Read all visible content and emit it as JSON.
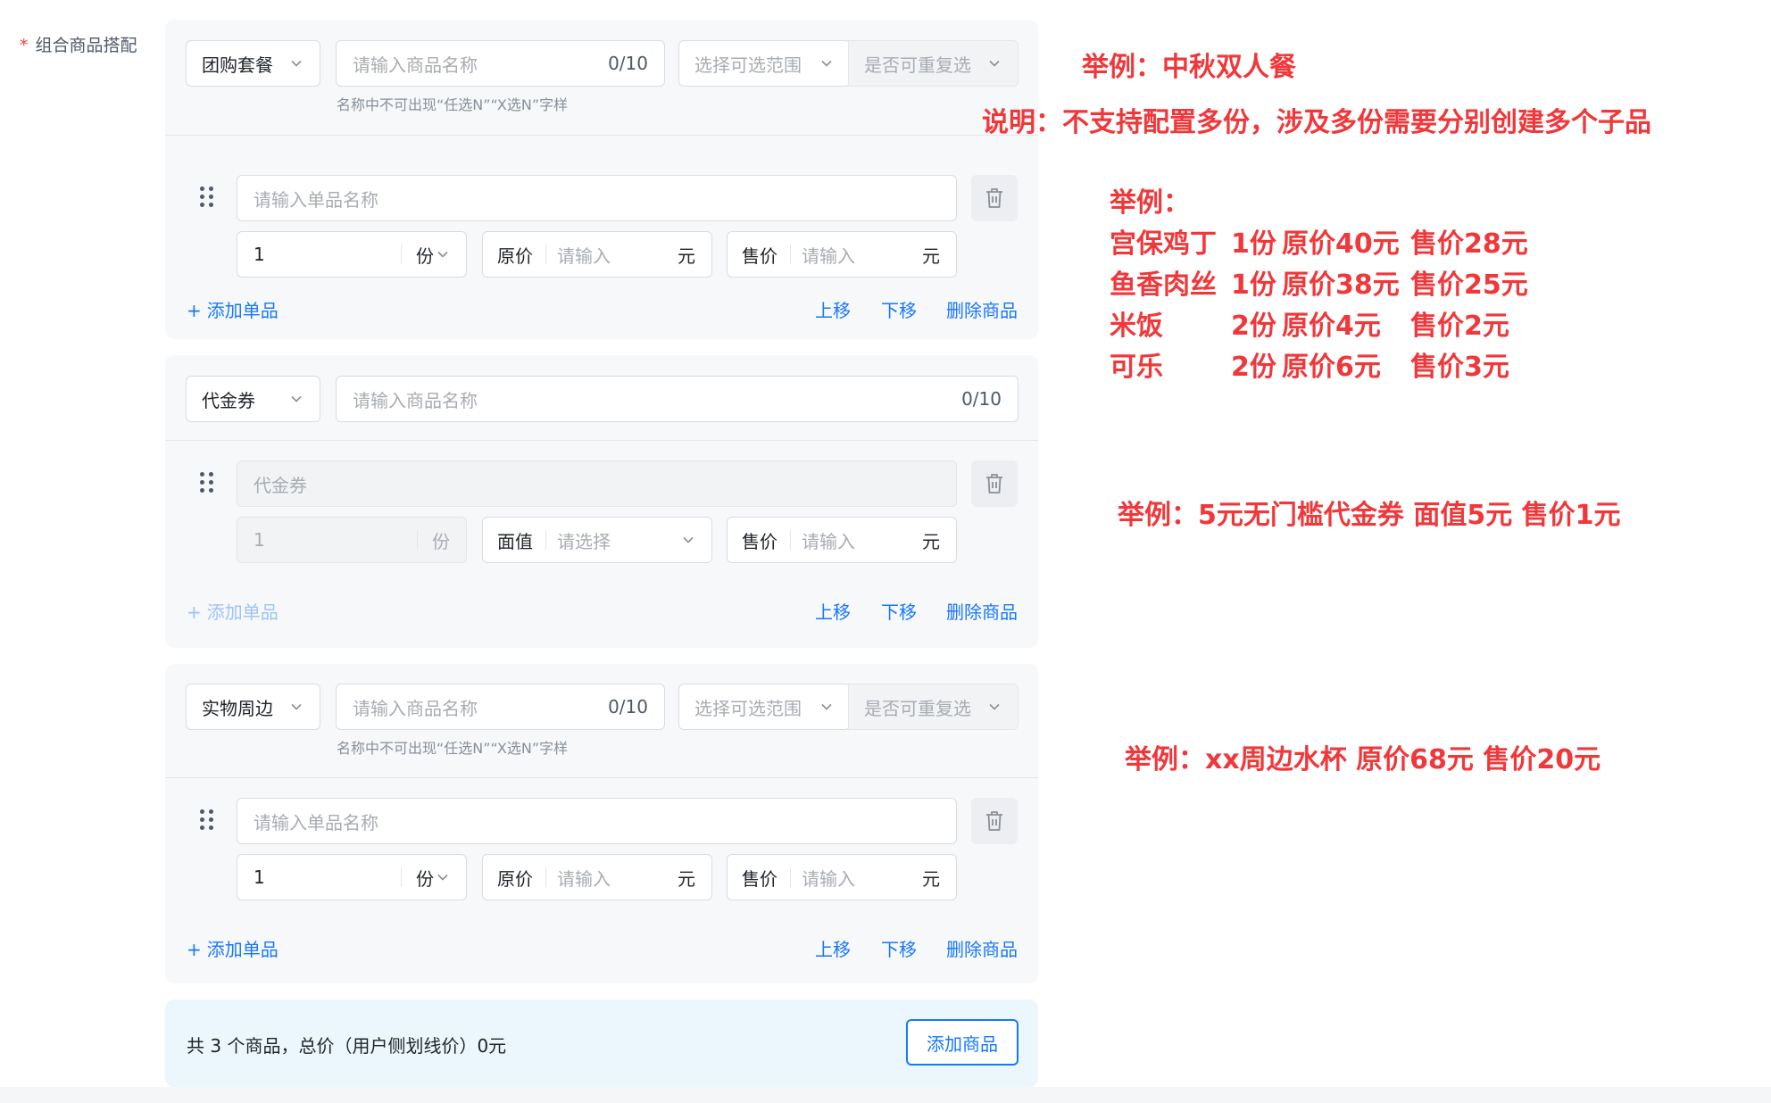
{
  "form": {
    "required_mark": "*",
    "label": "组合商品搭配"
  },
  "groups": [
    {
      "type_value": "团购套餐",
      "name_placeholder": "请输入商品名称",
      "name_count": "0/10",
      "range_placeholder": "选择可选范围",
      "repeat_placeholder": "是否可重复选",
      "hint": "名称中不可出现“任选N”“X选N”字样",
      "item": {
        "name_placeholder": "请输入单品名称",
        "qty_value": "1",
        "qty_unit": "份",
        "price_label": "原价",
        "price_placeholder": "请输入",
        "price_unit": "元",
        "sale_label": "售价",
        "sale_placeholder": "请输入",
        "sale_unit": "元"
      },
      "add_item": "添加单品",
      "move_up": "上移",
      "move_down": "下移",
      "delete": "删除商品"
    },
    {
      "type_value": "代金券",
      "name_placeholder": "请输入商品名称",
      "name_count": "0/10",
      "item": {
        "name_value": "代金券",
        "qty_value": "1",
        "qty_unit": "份",
        "price_label": "面值",
        "price_placeholder": "请选择",
        "sale_label": "售价",
        "sale_placeholder": "请输入",
        "sale_unit": "元"
      },
      "add_item": "添加单品",
      "move_up": "上移",
      "move_down": "下移",
      "delete": "删除商品"
    },
    {
      "type_value": "实物周边",
      "name_placeholder": "请输入商品名称",
      "name_count": "0/10",
      "range_placeholder": "选择可选范围",
      "repeat_placeholder": "是否可重复选",
      "hint": "名称中不可出现“任选N”“X选N”字样",
      "item": {
        "name_placeholder": "请输入单品名称",
        "qty_value": "1",
        "qty_unit": "份",
        "price_label": "原价",
        "price_placeholder": "请输入",
        "price_unit": "元",
        "sale_label": "售价",
        "sale_placeholder": "请输入",
        "sale_unit": "元"
      },
      "add_item": "添加单品",
      "move_up": "上移",
      "move_down": "下移",
      "delete": "删除商品"
    }
  ],
  "summary": {
    "text": "共 3 个商品，总价（用户侧划线价）0元",
    "add_button": "添加商品"
  },
  "annotations": {
    "example1_title": "举例：中秋双人餐",
    "example1_note": "说明：不支持配置多份，涉及多份需要分别创建多个子品",
    "example_list_title": "举例：",
    "example_list": [
      {
        "name": "宫保鸡丁",
        "qty": "1份",
        "orig": "原价40元",
        "sale": "售价28元"
      },
      {
        "name": "鱼香肉丝",
        "qty": "1份",
        "orig": "原价38元",
        "sale": "售价25元"
      },
      {
        "name": "米饭",
        "qty": "2份",
        "orig": "原价4元",
        "sale": "售价2元"
      },
      {
        "name": "可乐",
        "qty": "2份",
        "orig": "原价6元",
        "sale": "售价3元"
      }
    ],
    "example2": "举例：5元无门槛代金券 面值5元 售价1元",
    "example3": "举例：xx周边水杯 原价68元 售价20元"
  },
  "colors": {
    "primary": "#1677ff",
    "annotation_red": "#f0383b",
    "required_red": "#f53f3f",
    "card_bg": "#f7f8fa",
    "summary_bg": "#ebf7fc"
  },
  "icons": [
    "chevron-down-icon",
    "drag-handle-icon",
    "trash-icon",
    "plus-icon"
  ]
}
